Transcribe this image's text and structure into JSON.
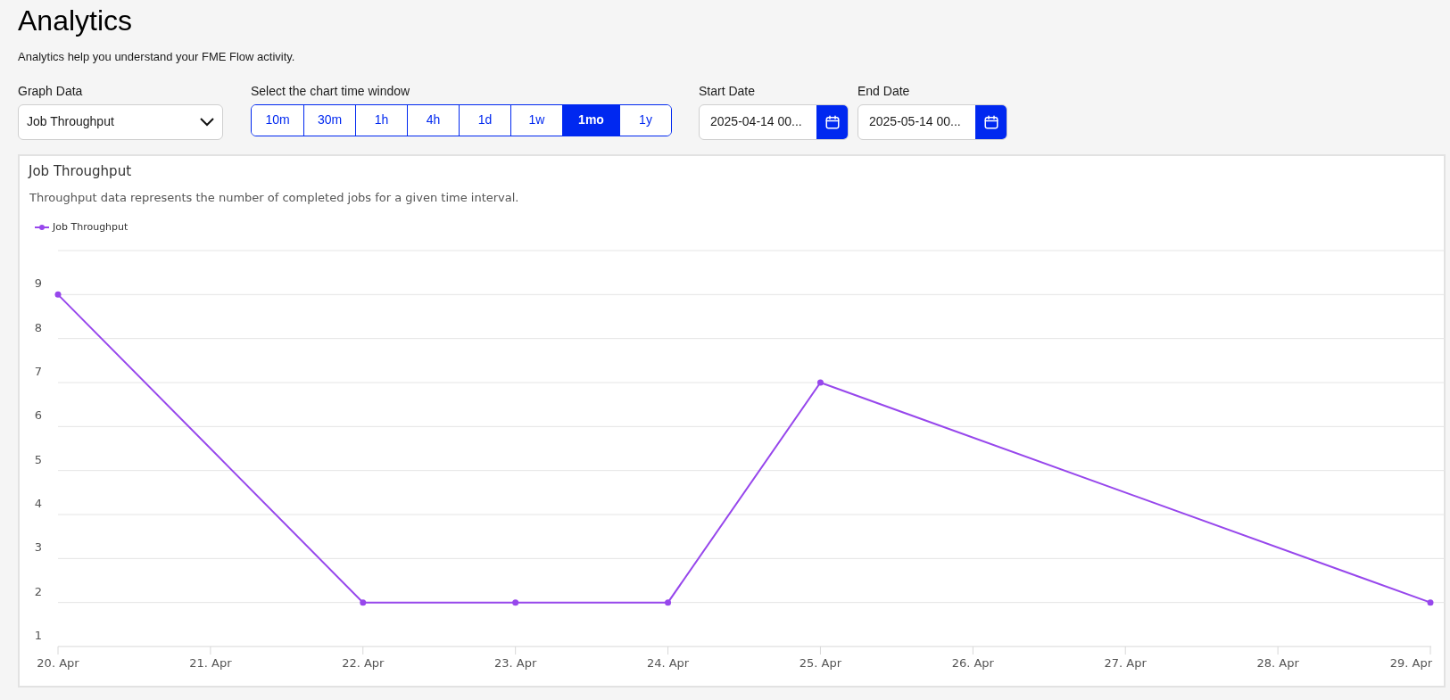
{
  "page": {
    "title": "Analytics",
    "subtitle": "Analytics help you understand your FME Flow activity."
  },
  "graph_data": {
    "label": "Graph Data",
    "value": "Job Throughput"
  },
  "time_window": {
    "label": "Select the chart time window",
    "options": [
      {
        "label": "10m",
        "selected": false
      },
      {
        "label": "30m",
        "selected": false
      },
      {
        "label": "1h",
        "selected": false
      },
      {
        "label": "4h",
        "selected": false
      },
      {
        "label": "1d",
        "selected": false
      },
      {
        "label": "1w",
        "selected": false
      },
      {
        "label": "1mo",
        "selected": true
      },
      {
        "label": "1y",
        "selected": false
      }
    ]
  },
  "start_date": {
    "label": "Start Date",
    "value": "2025-04-14 00..."
  },
  "end_date": {
    "label": "End Date",
    "value": "2025-05-14 00..."
  },
  "chart_panel": {
    "title": "Job Throughput",
    "description": "Throughput data represents the number of completed jobs for a given time interval.",
    "chart_data": {
      "type": "line",
      "categories": [
        "20. Apr",
        "21. Apr",
        "22. Apr",
        "23. Apr",
        "24. Apr",
        "25. Apr",
        "26. Apr",
        "27. Apr",
        "28. Apr",
        "29. Apr"
      ],
      "series": [
        {
          "name": "Job Throughput",
          "color": "#9747ec",
          "marker": true,
          "values": [
            9,
            null,
            2,
            2,
            2,
            7,
            null,
            null,
            null,
            2
          ]
        }
      ],
      "ylim": [
        1,
        10
      ],
      "grid": true,
      "yticks": [
        1,
        2,
        3,
        4,
        5,
        6,
        7,
        8,
        9
      ]
    }
  }
}
